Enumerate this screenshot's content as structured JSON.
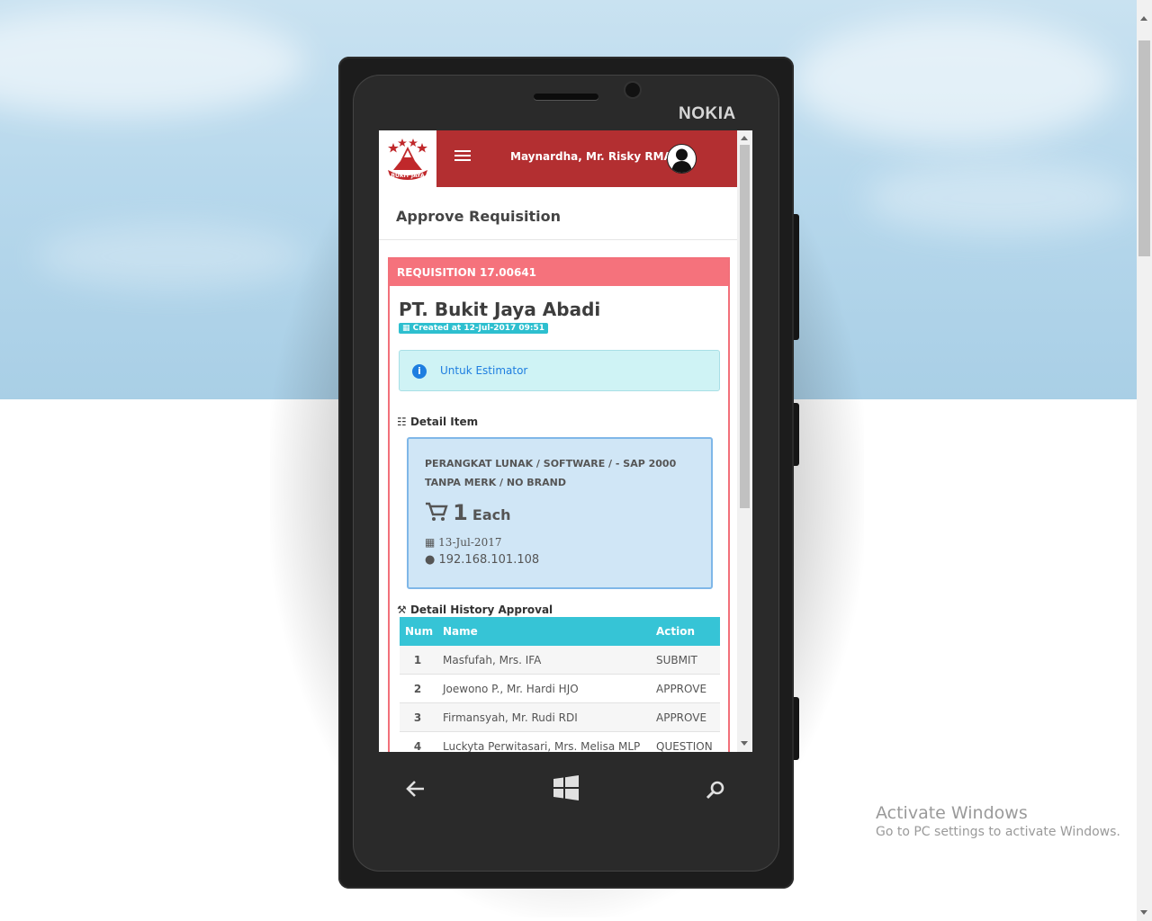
{
  "device": {
    "brand": "NOKIA"
  },
  "app": {
    "user_name": "Maynardha, Mr. Risky RMA",
    "page_title": "Approve Requisition",
    "requisition": {
      "header": "REQUISITION 17.00641",
      "company": "PT. Bukit Jaya Abadi",
      "created": "Created at 12-Jul-2017 09:51",
      "alert": "Untuk Estimator"
    },
    "detail_item": {
      "title": "Detail Item",
      "line1": "PERANGKAT LUNAK / SOFTWARE / - SAP 2000",
      "line2": "TANPA MERK / NO BRAND",
      "qty": "1",
      "unit": "Each",
      "date": "13-Jul-2017",
      "ip": "192.168.101.108"
    },
    "history": {
      "title": "Detail History Approval",
      "columns": [
        "Num",
        "Name",
        "Action"
      ],
      "rows": [
        {
          "num": "1",
          "name": "Masfufah, Mrs. IFA",
          "action": "SUBMIT"
        },
        {
          "num": "2",
          "name": "Joewono P., Mr. Hardi HJO",
          "action": "APPROVE"
        },
        {
          "num": "3",
          "name": "Firmansyah, Mr. Rudi RDI",
          "action": "APPROVE"
        },
        {
          "num": "4",
          "name": "Luckyta Perwitasari, Mrs. Melisa MLP",
          "action": "QUESTION"
        }
      ]
    }
  },
  "windows_watermark": {
    "title": "Activate Windows",
    "subtitle": "Go to PC settings to activate Windows."
  },
  "colors": {
    "topbar": "#b32f31",
    "panel_header": "#f5727c",
    "table_header": "#36c4d6",
    "alert_bg": "#cff3f5",
    "item_bg": "#d0e6f6"
  }
}
